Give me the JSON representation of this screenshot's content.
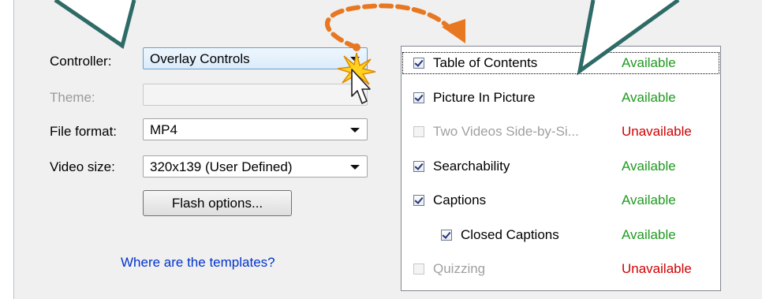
{
  "form": {
    "controller": {
      "label": "Controller:",
      "value": "Overlay Controls"
    },
    "theme": {
      "label": "Theme:",
      "value": ""
    },
    "file_format": {
      "label": "File format:",
      "value": "MP4"
    },
    "video_size": {
      "label": "Video size:",
      "value": "320x139 (User Defined)"
    },
    "flash_button": "Flash options...",
    "templates_link": "Where are the templates?"
  },
  "options": [
    {
      "label": "Table of Contents",
      "checked": true,
      "enabled": true,
      "status": "Available"
    },
    {
      "label": "Picture In Picture",
      "checked": true,
      "enabled": true,
      "status": "Available"
    },
    {
      "label": "Two Videos Side-by-Si...",
      "checked": false,
      "enabled": false,
      "status": "Unavailable"
    },
    {
      "label": "Searchability",
      "checked": true,
      "enabled": true,
      "status": "Available"
    },
    {
      "label": "Captions",
      "checked": true,
      "enabled": true,
      "status": "Available"
    },
    {
      "label": "Closed Captions",
      "checked": true,
      "enabled": true,
      "status": "Available"
    },
    {
      "label": "Quizzing",
      "checked": false,
      "enabled": false,
      "status": "Unavailable"
    }
  ],
  "colors": {
    "available": "#1f9a1f",
    "unavailable": "#d00000",
    "callout_outline": "#2e6b66",
    "curved_arrow": "#e87722",
    "link": "#0033cc"
  }
}
